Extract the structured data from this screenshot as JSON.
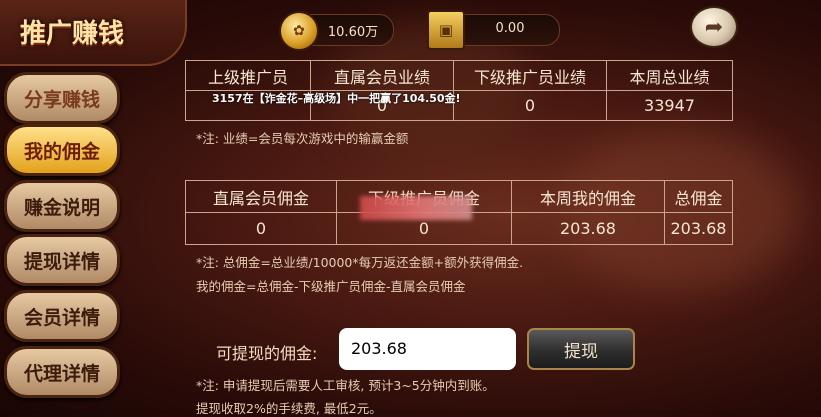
{
  "header": {
    "title": "推广赚钱"
  },
  "topbar": {
    "gold_amount": "10.60万",
    "safe_amount": "0.00"
  },
  "menu": {
    "items": [
      {
        "label": "分享赚钱"
      },
      {
        "label": "我的佣金"
      },
      {
        "label": "赚金说明"
      },
      {
        "label": "提现详情"
      },
      {
        "label": "会员详情"
      },
      {
        "label": "代理详情"
      }
    ]
  },
  "ticker": "3157在【诈金花–高级场】中一把赢了104.50金!",
  "performance": {
    "headers": [
      "上级推广员",
      "直属会员业绩",
      "下级推广员业绩",
      "本周总业绩"
    ],
    "values": [
      "",
      "0",
      "0",
      "33947"
    ],
    "note": "*注: 业绩=会员每次游戏中的输赢金额"
  },
  "commission": {
    "headers": [
      "直属会员佣金",
      "下级推广员佣金",
      "本周我的佣金",
      "总佣金"
    ],
    "values": [
      "0",
      "0",
      "203.68",
      "203.68"
    ],
    "note1": "*注: 总佣金=总业绩/10000*每万返还金额+额外获得佣金.",
    "note2": "我的佣金=总佣金-下级推广员佣金-直属会员佣金"
  },
  "withdraw": {
    "label": "可提现的佣金:",
    "amount": "203.68",
    "button": "提现",
    "note1": "*注: 申请提现后需要人工审核, 预计3~5分钟内到账。",
    "note2": "提现收取2%的手续费, 最低2元。"
  },
  "colors": {
    "accent": "#e2a21c",
    "panel_border": "#caa68e"
  }
}
